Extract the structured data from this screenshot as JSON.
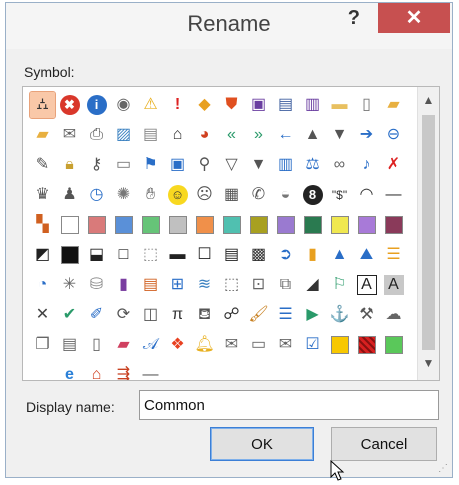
{
  "dialog": {
    "title": "Rename",
    "help_label": "?",
    "close_label": "✕"
  },
  "symbol_label": "Symbol:",
  "display_name": {
    "label": "Display name:",
    "value": "Common"
  },
  "buttons": {
    "ok": "OK",
    "cancel": "Cancel"
  },
  "scrollbar": {
    "up": "▲",
    "down": "▼"
  },
  "symbols": [
    {
      "name": "org-chart-icon",
      "g": "⛼",
      "c": "#333",
      "sel": true
    },
    {
      "name": "error-icon",
      "g": "✖",
      "c": "#fff",
      "bg": "#d9372b",
      "round": true
    },
    {
      "name": "info-icon",
      "g": "i",
      "c": "#fff",
      "bg": "#2a6ec7",
      "round": true
    },
    {
      "name": "ring-icon",
      "g": "◉",
      "c": "#666"
    },
    {
      "name": "warning-icon",
      "g": "⚠",
      "c": "#e8b020"
    },
    {
      "name": "exclamation-icon",
      "g": "!",
      "c": "#d22",
      "bold": true
    },
    {
      "name": "diamond-warning-icon",
      "g": "◆",
      "c": "#e8a020"
    },
    {
      "name": "shield-icon",
      "g": "⛊",
      "c": "#e05020"
    },
    {
      "name": "save-icon",
      "g": "▣",
      "c": "#6a3ea0"
    },
    {
      "name": "save-as-icon",
      "g": "▤",
      "c": "#4060a0"
    },
    {
      "name": "save-all-icon",
      "g": "▥",
      "c": "#6a3ea0"
    },
    {
      "name": "folder-icon",
      "g": "▬",
      "c": "#e8c060"
    },
    {
      "name": "page-icon",
      "g": "▯",
      "c": "#777"
    },
    {
      "name": "open-folder-icon",
      "g": "▰",
      "c": "#e8b040"
    },
    {
      "name": "folder-open-icon",
      "g": "▰",
      "c": "#e8b040"
    },
    {
      "name": "envelope-folder-icon",
      "g": "✉",
      "c": "#666"
    },
    {
      "name": "printer-icon",
      "g": "⎙",
      "c": "#555"
    },
    {
      "name": "picture-icon",
      "g": "▨",
      "c": "#3a80c0"
    },
    {
      "name": "document-icon",
      "g": "▤",
      "c": "#888"
    },
    {
      "name": "home-icon",
      "g": "⌂",
      "c": "#333"
    },
    {
      "name": "pie-chart-icon",
      "g": "◕",
      "c": "#d04020"
    },
    {
      "name": "back-arrows-icon",
      "g": "«",
      "c": "#2a9a6a"
    },
    {
      "name": "forward-arrows-icon",
      "g": "»",
      "c": "#2a9a6a"
    },
    {
      "name": "left-arrow-icon",
      "g": "←",
      "c": "#2a6ec7"
    },
    {
      "name": "up-triangle-icon",
      "g": "▲",
      "c": "#555"
    },
    {
      "name": "down-triangle-icon",
      "g": "▼",
      "c": "#555"
    },
    {
      "name": "right-arrow-icon",
      "g": "➔",
      "c": "#2a6ec7"
    },
    {
      "name": "back-circle-icon",
      "g": "⊖",
      "c": "#2a6ec7"
    },
    {
      "name": "pin-icon",
      "g": "✎",
      "c": "#555"
    },
    {
      "name": "lock-icon",
      "g": "🔒︎",
      "c": "#c8a030"
    },
    {
      "name": "key-icon",
      "g": "⚷",
      "c": "#555"
    },
    {
      "name": "scroll-icon",
      "g": "▭",
      "c": "#777"
    },
    {
      "name": "flag-icon",
      "g": "⚑",
      "c": "#2a6ec7"
    },
    {
      "name": "window-icon",
      "g": "▣",
      "c": "#2a6ec7"
    },
    {
      "name": "magnifier-icon",
      "g": "⚲",
      "c": "#555"
    },
    {
      "name": "filter-icon",
      "g": "▽",
      "c": "#555"
    },
    {
      "name": "filter-solid-icon",
      "g": "▼",
      "c": "#555"
    },
    {
      "name": "book-icon",
      "g": "▥",
      "c": "#2a6ec7"
    },
    {
      "name": "scales-icon",
      "g": "⚖",
      "c": "#2a6ec7"
    },
    {
      "name": "rings-icon",
      "g": "∞",
      "c": "#666"
    },
    {
      "name": "microphone-icon",
      "g": "♪",
      "c": "#2a6ec7"
    },
    {
      "name": "mute-icon",
      "g": "✗",
      "c": "#d22"
    },
    {
      "name": "person-tie-icon",
      "g": "♛",
      "c": "#555"
    },
    {
      "name": "person-icon",
      "g": "♟",
      "c": "#555"
    },
    {
      "name": "clock-icon",
      "g": "◷",
      "c": "#2a6ec7"
    },
    {
      "name": "sparkle-icon",
      "g": "✺",
      "c": "#777"
    },
    {
      "name": "hand-icon",
      "g": "✋︎",
      "c": "#555"
    },
    {
      "name": "smiley-icon",
      "g": "☺",
      "c": "#333",
      "bg": "#f8d820",
      "round": true
    },
    {
      "name": "frown-icon",
      "g": "☹",
      "c": "#555"
    },
    {
      "name": "calculator-icon",
      "g": "▦",
      "c": "#555"
    },
    {
      "name": "phone-icon",
      "g": "✆",
      "c": "#555"
    },
    {
      "name": "piggy-bank-icon",
      "g": "◒",
      "c": "#777"
    },
    {
      "name": "eight-ball-icon",
      "g": "8",
      "c": "#fff",
      "bg": "#222",
      "round": true
    },
    {
      "name": "quote-dollar-icon",
      "g": "\"$\"",
      "c": "#333",
      "small": true
    },
    {
      "name": "eye-icon",
      "g": "◠",
      "c": "#333"
    },
    {
      "name": "dash-icon",
      "g": "—",
      "c": "#333"
    },
    {
      "name": "mosaic-icon",
      "g": "▚",
      "c": "#d06020"
    },
    {
      "name": "square-white-icon",
      "sq": "#ffffff"
    },
    {
      "name": "square-rose-icon",
      "sq": "#d97a7a"
    },
    {
      "name": "square-blue-icon",
      "sq": "#5a90d8"
    },
    {
      "name": "square-green-icon",
      "sq": "#66c478"
    },
    {
      "name": "square-silver-icon",
      "sq": "#c0c0c0"
    },
    {
      "name": "square-orange-icon",
      "sq": "#f0904a"
    },
    {
      "name": "square-teal-icon",
      "sq": "#50c0b0"
    },
    {
      "name": "square-olive-icon",
      "sq": "#a8a020"
    },
    {
      "name": "square-purple-icon",
      "sq": "#9a7ad0"
    },
    {
      "name": "square-darkgreen-icon",
      "sq": "#2a7a50"
    },
    {
      "name": "square-yellow-icon",
      "sq": "#f0e850"
    },
    {
      "name": "square-lavender-icon",
      "sq": "#a87ad8"
    },
    {
      "name": "square-maroon-icon",
      "sq": "#8a3a5a"
    },
    {
      "name": "half-square-icon",
      "g": "◩",
      "c": "#222"
    },
    {
      "name": "square-black-icon",
      "sq": "#111111"
    },
    {
      "name": "square-half-black-icon",
      "g": "⬓",
      "c": "#222"
    },
    {
      "name": "square-outline-icon",
      "g": "□",
      "c": "#222"
    },
    {
      "name": "square-dotted-icon",
      "g": "⬚",
      "c": "#888"
    },
    {
      "name": "square-bar-icon",
      "g": "▬",
      "c": "#222"
    },
    {
      "name": "square-bold-outline-icon",
      "g": "☐",
      "c": "#222"
    },
    {
      "name": "square-stripe-icon",
      "g": "▤",
      "c": "#222"
    },
    {
      "name": "checker-icon",
      "g": "▩",
      "c": "#333"
    },
    {
      "name": "circle-arrow-icon",
      "g": "➲",
      "c": "#2a6ec7"
    },
    {
      "name": "bar-chart-icon",
      "g": "▮",
      "c": "#e8a020"
    },
    {
      "name": "cone-icon",
      "g": "▲",
      "c": "#2a6ec7"
    },
    {
      "name": "mountains-icon",
      "g": "⛰",
      "c": "#2a6ec7"
    },
    {
      "name": "gantt-icon",
      "g": "☰",
      "c": "#e8a020"
    },
    {
      "name": "pie-icon",
      "g": "◔",
      "c": "#2a6ec7"
    },
    {
      "name": "web-icon",
      "g": "✳",
      "c": "#666"
    },
    {
      "name": "cylinders-icon",
      "g": "⛁",
      "c": "#888"
    },
    {
      "name": "purple-book-icon",
      "g": "▮",
      "c": "#7a3ea0"
    },
    {
      "name": "form-icon",
      "g": "▤",
      "c": "#d06020"
    },
    {
      "name": "flowchart-icon",
      "g": "⊞",
      "c": "#2a6ec7"
    },
    {
      "name": "landscape-icon",
      "g": "≋",
      "c": "#3a80c0"
    },
    {
      "name": "dotted-frame-icon",
      "g": "⬚",
      "c": "#666"
    },
    {
      "name": "dotted-frame-cross-icon",
      "g": "⊡",
      "c": "#666"
    },
    {
      "name": "frame-icon",
      "g": "⧉",
      "c": "#666"
    },
    {
      "name": "triangle-stripe-icon",
      "g": "◢",
      "c": "#333"
    },
    {
      "name": "flags-icon",
      "g": "⚐",
      "c": "#2a9a6a"
    },
    {
      "name": "letter-a-icon",
      "g": "A",
      "c": "#222",
      "box": true
    },
    {
      "name": "letter-a-shade-icon",
      "g": "A",
      "c": "#222",
      "bg": "#c8c8c8"
    },
    {
      "name": "x-mark-icon",
      "g": "✕",
      "c": "#444"
    },
    {
      "name": "check-icon",
      "g": "✔",
      "c": "#2a9a6a"
    },
    {
      "name": "ruler-pen-icon",
      "g": "✐",
      "c": "#2a6ec7"
    },
    {
      "name": "refresh-icon",
      "g": "⟳",
      "c": "#555"
    },
    {
      "name": "split-icon",
      "g": "◫",
      "c": "#555"
    },
    {
      "name": "pi-icon",
      "g": "π",
      "c": "#333"
    },
    {
      "name": "paint-bucket-icon",
      "g": "⛾",
      "c": "#555"
    },
    {
      "name": "binoculars-icon",
      "g": "☍",
      "c": "#333"
    },
    {
      "name": "brush-icon",
      "g": "🖌︎",
      "c": "#c88020"
    },
    {
      "name": "bullets-icon",
      "g": "☰",
      "c": "#2a6ec7"
    },
    {
      "name": "play-icon",
      "g": "▶",
      "c": "#2a9a6a"
    },
    {
      "name": "anchor-icon",
      "g": "⚓",
      "c": "#2a6ec7"
    },
    {
      "name": "toolbox-icon",
      "g": "⚒",
      "c": "#555"
    },
    {
      "name": "shape-outline-icon",
      "g": "☁",
      "c": "#666"
    },
    {
      "name": "copy-icon",
      "g": "❐",
      "c": "#666"
    },
    {
      "name": "document-lines-icon",
      "g": "▤",
      "c": "#666"
    },
    {
      "name": "blank-page-icon",
      "g": "▯",
      "c": "#666"
    },
    {
      "name": "eraser-icon",
      "g": "▰",
      "c": "#d04060"
    },
    {
      "name": "script-a-icon",
      "g": "𝒜",
      "c": "#2a6ec7"
    },
    {
      "name": "windows-flag-icon",
      "g": "❖",
      "c": "#e84020"
    },
    {
      "name": "bell-icon",
      "g": "🔔︎",
      "c": "#e8b020"
    },
    {
      "name": "open-envelope-icon",
      "g": "✉",
      "c": "#666"
    },
    {
      "name": "address-card-icon",
      "g": "▭",
      "c": "#666"
    },
    {
      "name": "email-card-icon",
      "g": "✉",
      "c": "#666"
    },
    {
      "name": "checkmark-form-icon",
      "g": "☑",
      "c": "#2a6ec7"
    },
    {
      "name": "square-gold-icon",
      "sq": "#f8c800"
    },
    {
      "name": "square-red-hatch-icon",
      "sq": "#d82020",
      "hatch": true
    },
    {
      "name": "square-lime-icon",
      "sq": "#5ac85a"
    },
    {
      "name": "blank-icon",
      "g": "",
      "c": "#000"
    },
    {
      "name": "internet-explorer-icon",
      "g": "e",
      "c": "#2a80d8",
      "bold": true
    },
    {
      "name": "network-home-icon",
      "g": "⌂",
      "c": "#d04020"
    },
    {
      "name": "signpost-icon",
      "g": "⇶",
      "c": "#c84020"
    },
    {
      "name": "horizontal-line-icon",
      "g": "—",
      "c": "#555"
    }
  ]
}
